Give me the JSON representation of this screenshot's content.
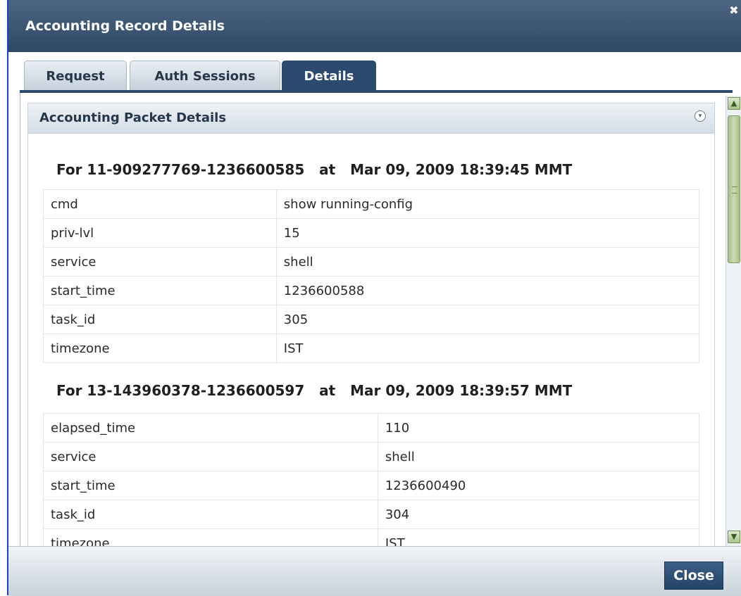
{
  "dialog": {
    "title": "Accounting Record Details",
    "close_icon": "✖"
  },
  "tabs": [
    {
      "label": "Request",
      "active": false
    },
    {
      "label": "Auth Sessions",
      "active": false
    },
    {
      "label": "Details",
      "active": true
    }
  ],
  "panel": {
    "title": "Accounting Packet Details",
    "collapse_icon": "chevron-down-circle-icon",
    "records": [
      {
        "header": "For 11-909277769-1236600585   at   Mar 09, 2009 18:39:45 MMT",
        "rows": [
          {
            "key": "cmd",
            "value": "show running-config"
          },
          {
            "key": "priv-lvl",
            "value": "15"
          },
          {
            "key": "service",
            "value": "shell"
          },
          {
            "key": "start_time",
            "value": "1236600588"
          },
          {
            "key": "task_id",
            "value": "305"
          },
          {
            "key": "timezone",
            "value": "IST"
          }
        ]
      },
      {
        "header": "For 13-143960378-1236600597   at   Mar 09, 2009 18:39:57 MMT",
        "rows": [
          {
            "key": "elapsed_time",
            "value": "110"
          },
          {
            "key": "service",
            "value": "shell"
          },
          {
            "key": "start_time",
            "value": "1236600490"
          },
          {
            "key": "task_id",
            "value": "304"
          },
          {
            "key": "timezone",
            "value": "IST"
          }
        ]
      }
    ]
  },
  "footer": {
    "close_label": "Close"
  },
  "colors": {
    "header_dark": "#2c4a6e",
    "scrollbar_green": "#a6bf8a"
  }
}
